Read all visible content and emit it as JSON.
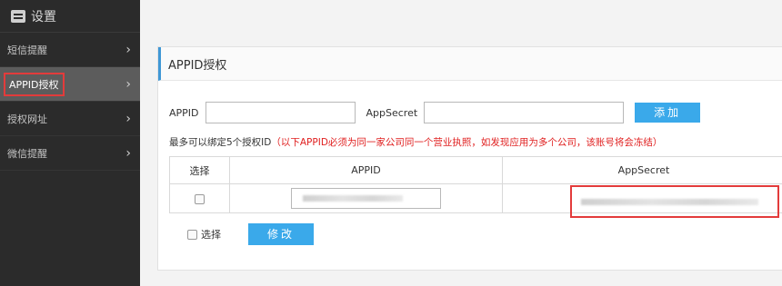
{
  "sidebar": {
    "title": "设置",
    "items": [
      {
        "label": "短信提醒"
      },
      {
        "label": "APPID授权"
      },
      {
        "label": "授权网址"
      },
      {
        "label": "微信提醒"
      }
    ]
  },
  "panel": {
    "title": "APPID授权",
    "form": {
      "appid_label": "APPID",
      "appid_value": "",
      "secret_label": "AppSecret",
      "secret_value": "",
      "add_button": "添加"
    },
    "notice": {
      "text": "最多可以绑定5个授权ID",
      "warning": "（以下APPID必须为同一家公司同一个营业执照，如发现应用为多个公司，该账号将会冻结）"
    },
    "table": {
      "headers": [
        "选择",
        "APPID",
        "AppSecret"
      ]
    },
    "footer": {
      "select_label": "选择",
      "edit_button": "修改"
    }
  },
  "colors": {
    "accent": "#3aa9ea",
    "sidebar_bg": "#2b2b2b",
    "highlight": "#e33b3b",
    "warning": "#e02020"
  }
}
